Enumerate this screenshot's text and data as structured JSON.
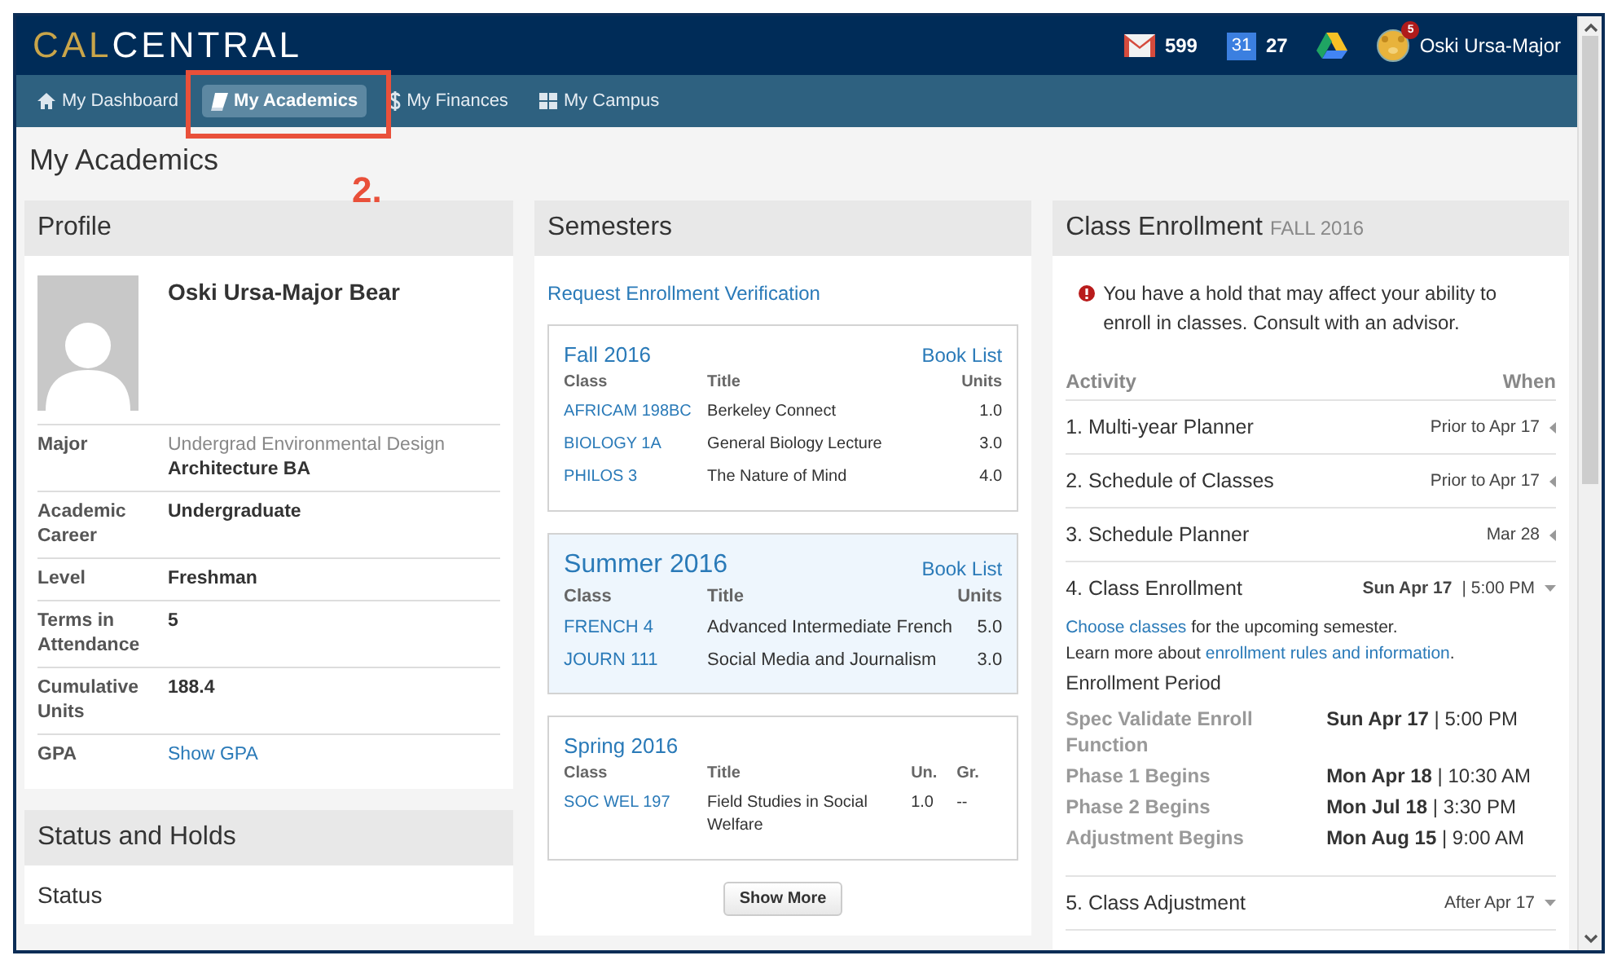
{
  "header": {
    "logo_part_1": "CAL",
    "logo_part_2": "CENTRAL",
    "mail_count": "599",
    "calendar_day": "31",
    "calendar_count": "27",
    "notification_count": "5",
    "user_name": "Oski Ursa-Major"
  },
  "nav": [
    {
      "label": "My Dashboard",
      "selected": false
    },
    {
      "label": "My Academics",
      "selected": true
    },
    {
      "label": "My Finances",
      "selected": false
    },
    {
      "label": "My Campus",
      "selected": false
    }
  ],
  "annotation": {
    "step": "2."
  },
  "page_title": "My Academics",
  "profile": {
    "title": "Profile",
    "name": "Oski Ursa-Major Bear",
    "rows": [
      {
        "label": "Major",
        "values": [
          {
            "text": "Undergrad Environmental Design",
            "muted": true
          },
          {
            "text": "Architecture BA",
            "muted": false
          }
        ]
      },
      {
        "label": "Academic Career",
        "values": [
          {
            "text": "Undergraduate",
            "muted": false
          }
        ]
      },
      {
        "label": "Level",
        "values": [
          {
            "text": "Freshman",
            "muted": false
          }
        ]
      },
      {
        "label": "Terms in Attendance",
        "values": [
          {
            "text": "5",
            "muted": false
          }
        ]
      },
      {
        "label": "Cumulative Units",
        "values": [
          {
            "text": "188.4",
            "muted": false
          }
        ]
      },
      {
        "label": "GPA",
        "link": "Show GPA"
      }
    ]
  },
  "status_panel": {
    "title": "Status and Holds",
    "first_item": "Status"
  },
  "semesters": {
    "title": "Semesters",
    "verification_link": "Request Enrollment Verification",
    "show_more": "Show More",
    "cards": [
      {
        "term": "Fall 2016",
        "highlighted": false,
        "book_list": "Book List",
        "columns": [
          "Class",
          "Title",
          "Units"
        ],
        "rows": [
          [
            "AFRICAM 198BC",
            "Berkeley Connect",
            "1.0"
          ],
          [
            "BIOLOGY 1A",
            "General Biology Lecture",
            "3.0"
          ],
          [
            "PHILOS 3",
            "The Nature of Mind",
            "4.0"
          ]
        ]
      },
      {
        "term": "Summer 2016",
        "highlighted": true,
        "book_list": "Book List",
        "columns": [
          "Class",
          "Title",
          "Units"
        ],
        "rows": [
          [
            "FRENCH 4",
            "Advanced Intermediate French",
            "5.0"
          ],
          [
            "JOURN 111",
            "Social Media and Journalism",
            "3.0"
          ]
        ]
      },
      {
        "term": "Spring 2016",
        "highlighted": false,
        "columns": [
          "Class",
          "Title",
          "Un.",
          "Gr."
        ],
        "rows": [
          [
            "SOC WEL 197",
            "Field Studies in Social Welfare",
            "1.0",
            "--"
          ]
        ]
      }
    ]
  },
  "enrollment": {
    "title": "Class Enrollment",
    "term": "FALL 2016",
    "hold_message": "You have a hold that may affect your ability to enroll in classes. Consult with an advisor.",
    "columns": [
      "Activity",
      "When"
    ],
    "activities": [
      {
        "name": "1. Multi-year Planner",
        "when": "Prior to Apr 17",
        "expanded": false
      },
      {
        "name": "2. Schedule of Classes",
        "when": "Prior to Apr 17",
        "expanded": false
      },
      {
        "name": "3. Schedule Planner",
        "when": "Mar 28",
        "expanded": false
      },
      {
        "name": "4. Class Enrollment",
        "when": "**Sun Apr 17** | 5:00 PM",
        "expanded": true,
        "details": {
          "lines": [
            {
              "link": "Choose classes",
              "after": " for the upcoming semester."
            },
            {
              "before": "Learn more about ",
              "link": "enrollment rules and information",
              "after": "."
            }
          ],
          "period_title": "Enrollment Period",
          "periods": [
            {
              "label": "Spec Validate Enroll Function",
              "when": "**Sun Apr 17** | 5:00 PM"
            },
            {
              "label": "Phase 1 Begins",
              "when": "**Mon Apr 18** | 10:30 AM"
            },
            {
              "label": "Phase 2 Begins",
              "when": "**Mon Jul 18** | 3:30 PM"
            },
            {
              "label": "Adjustment Begins",
              "when": "**Mon Aug 15** | 9:00 AM"
            }
          ]
        }
      },
      {
        "name": "5. Class Adjustment",
        "when": "After Apr 17",
        "expanded": true
      }
    ]
  }
}
